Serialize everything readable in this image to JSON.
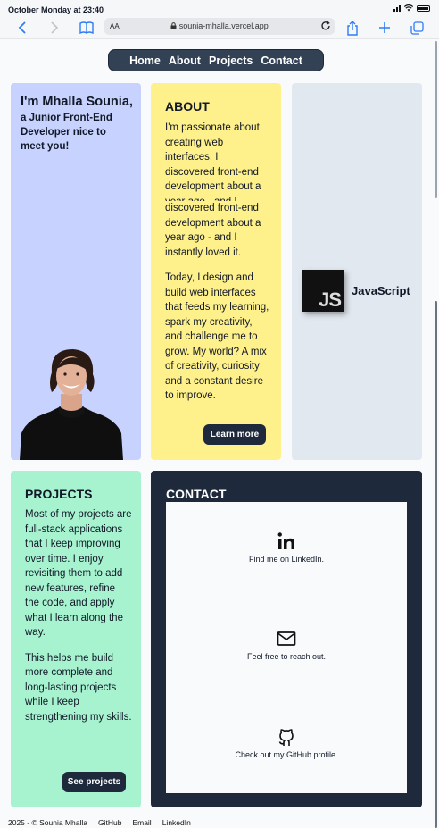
{
  "status_bar": {
    "time": "October Monday at 23:40"
  },
  "browser": {
    "text_size_label": "AA",
    "url": "sounia-mhalla.vercel.app"
  },
  "nav": {
    "items": [
      "Home",
      "About",
      "Projects",
      "Contact"
    ]
  },
  "intro": {
    "heading": "I'm Mhalla Sounia,",
    "subheading": "a Junior Front-End Developer  nice to meet you!"
  },
  "about": {
    "title": "ABOUT",
    "p1": "I'm passionate about creating web interfaces. I discovered front-end development about a year ago - and I",
    "p2": "discovered front-end development about a year ago - and I instantly loved it.",
    "p3": "Today, I design and build web interfaces that feeds my learning, spark my creativity, and challenge me to grow. My world? A mix of creativity, curiosity and a constant desire to improve.",
    "button": "Learn more"
  },
  "skills": {
    "logo_text": "JS",
    "label": "JavaScript"
  },
  "projects": {
    "title": "PROJECTS",
    "p1": "Most of my projects are full-stack applications that I keep improving over time. I enjoy revisiting them to add new features, refine the code, and apply what I learn along the way.",
    "p2": "This helps me build more complete and long-lasting projects while I keep strengthening my skills.",
    "button": "See projects"
  },
  "contact": {
    "title": "CONTACT",
    "items": [
      {
        "icon": "linkedin-icon",
        "label": "Find me on LinkedIn."
      },
      {
        "icon": "mail-icon",
        "label": "Feel free to reach out."
      },
      {
        "icon": "github-icon",
        "label": "Check out my GitHub profile."
      }
    ]
  },
  "footer": {
    "copyright": "2025 - © Sounia Mhalla",
    "links": [
      "GitHub",
      "Email",
      "LinkedIn"
    ]
  },
  "colors": {
    "nav_bg": "#334155",
    "intro_bg": "#c7d2fe",
    "about_bg": "#fef08a",
    "skills_bg": "#e2e8f0",
    "projects_bg": "#a7f3d0",
    "contact_bg": "#1e293b",
    "browser_accent": "#2f7cf6"
  }
}
